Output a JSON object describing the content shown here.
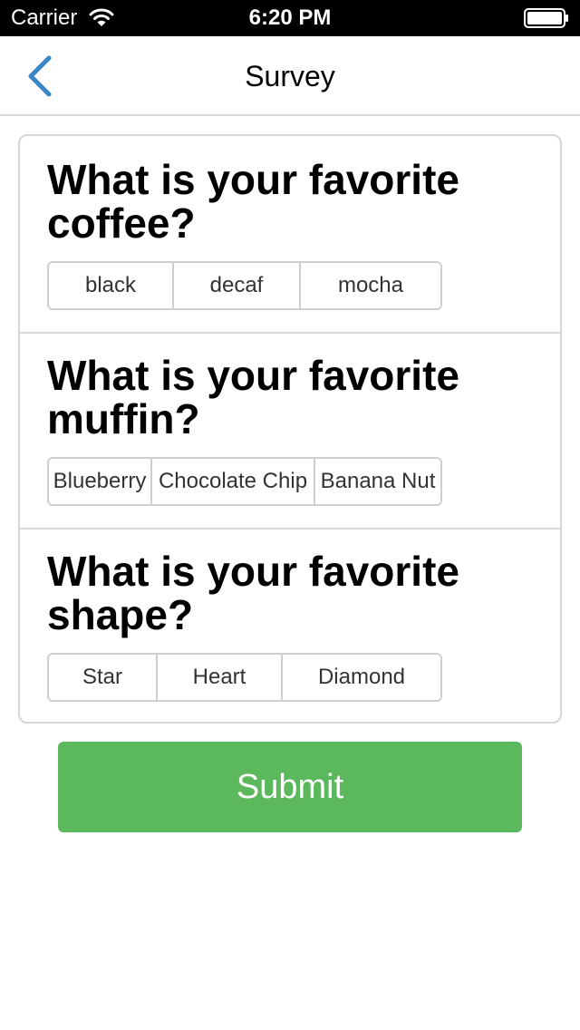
{
  "status_bar": {
    "carrier": "Carrier",
    "time": "6:20 PM",
    "icons": [
      "wifi-icon",
      "battery-icon"
    ]
  },
  "nav": {
    "title": "Survey",
    "back_icon": "chevron-left-icon",
    "accent_color": "#3a85c6"
  },
  "questions": [
    {
      "title": "What is your favorite coffee?",
      "options": [
        "black",
        "decaf",
        "mocha"
      ]
    },
    {
      "title": "What is your favorite muffin?",
      "options": [
        "Blueberry",
        "Chocolate Chip",
        "Banana Nut"
      ]
    },
    {
      "title": "What is your favorite shape?",
      "options": [
        "Star",
        "Heart",
        "Diamond"
      ]
    }
  ],
  "submit": {
    "label": "Submit",
    "color": "#5cb85c"
  }
}
